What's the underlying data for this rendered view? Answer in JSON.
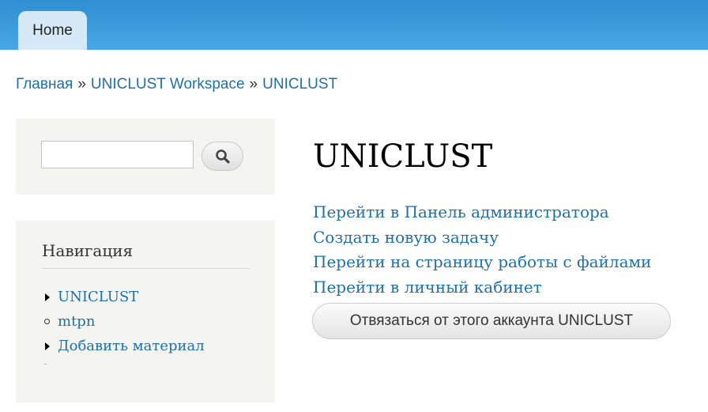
{
  "header": {
    "tabs": [
      {
        "label": "Home"
      }
    ],
    "accent_color": "#3a9ad9"
  },
  "breadcrumb": {
    "items": [
      {
        "label": "Главная"
      },
      {
        "label": "UNICLUST Workspace"
      },
      {
        "label": "UNICLUST"
      }
    ],
    "separator": "»"
  },
  "sidebar": {
    "search": {
      "value": "",
      "placeholder": "",
      "button_icon": "search-icon"
    },
    "navigation": {
      "title": "Навигация",
      "items": [
        {
          "label": "UNICLUST",
          "marker": "triangle"
        },
        {
          "label": "mtpn",
          "marker": "circle"
        },
        {
          "label": "Добавить материал",
          "marker": "triangle"
        }
      ]
    }
  },
  "main": {
    "title": "UNICLUST",
    "links": [
      {
        "label": "Перейти в Панель администратора"
      },
      {
        "label": "Создать новую задачу"
      },
      {
        "label": "Перейти на страницу работы с файлами"
      },
      {
        "label": "Перейти в личный кабинет"
      }
    ],
    "unlink_button": "Отвязаться от этого аккаунта UNICLUST"
  },
  "colors": {
    "link": "#1f6fa8",
    "sidebar_bg": "#f4f4f1"
  }
}
